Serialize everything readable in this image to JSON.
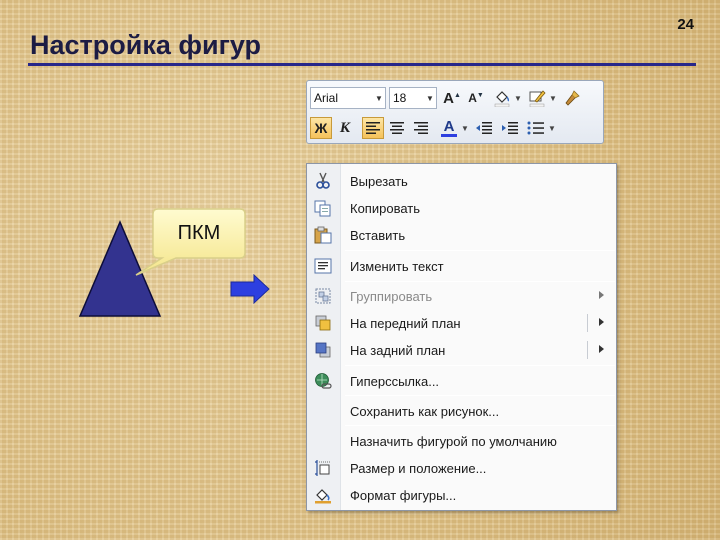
{
  "slide": {
    "title": "Настройка фигур",
    "page_number": "24"
  },
  "callout": {
    "text": "ПКМ"
  },
  "mini_toolbar": {
    "font_name": "Arial",
    "font_size": "18",
    "bold_label": "Ж",
    "italic_label": "К",
    "font_color_label": "A",
    "grow_font_label": "A",
    "shrink_font_label": "A"
  },
  "context_menu": {
    "items": [
      {
        "label": "Вырезать",
        "icon": "scissors-icon"
      },
      {
        "label": "Копировать",
        "icon": "copy-icon"
      },
      {
        "label": "Вставить",
        "icon": "paste-icon"
      },
      {
        "label": "Изменить текст",
        "icon": "edit-text-icon"
      },
      {
        "label": "Группировать",
        "icon": "group-icon",
        "disabled": true,
        "submenu": true
      },
      {
        "label": "На передний план",
        "icon": "bring-forward-icon",
        "submenu": true
      },
      {
        "label": "На задний план",
        "icon": "send-backward-icon",
        "submenu": true
      },
      {
        "label": "Гиперссылка...",
        "icon": "hyperlink-icon"
      },
      {
        "label": "Сохранить как рисунок...",
        "icon": ""
      },
      {
        "label": "Назначить фигурой по умолчанию",
        "icon": ""
      },
      {
        "label": "Размер и положение...",
        "icon": "size-position-icon"
      },
      {
        "label": "Формат фигуры...",
        "icon": "format-shape-icon"
      }
    ]
  },
  "colors": {
    "title_rule": "#27278a",
    "triangle_fill": "#33338f",
    "callout_fill": "#fbf3a8",
    "arrow_fill": "#2d3fe0"
  }
}
